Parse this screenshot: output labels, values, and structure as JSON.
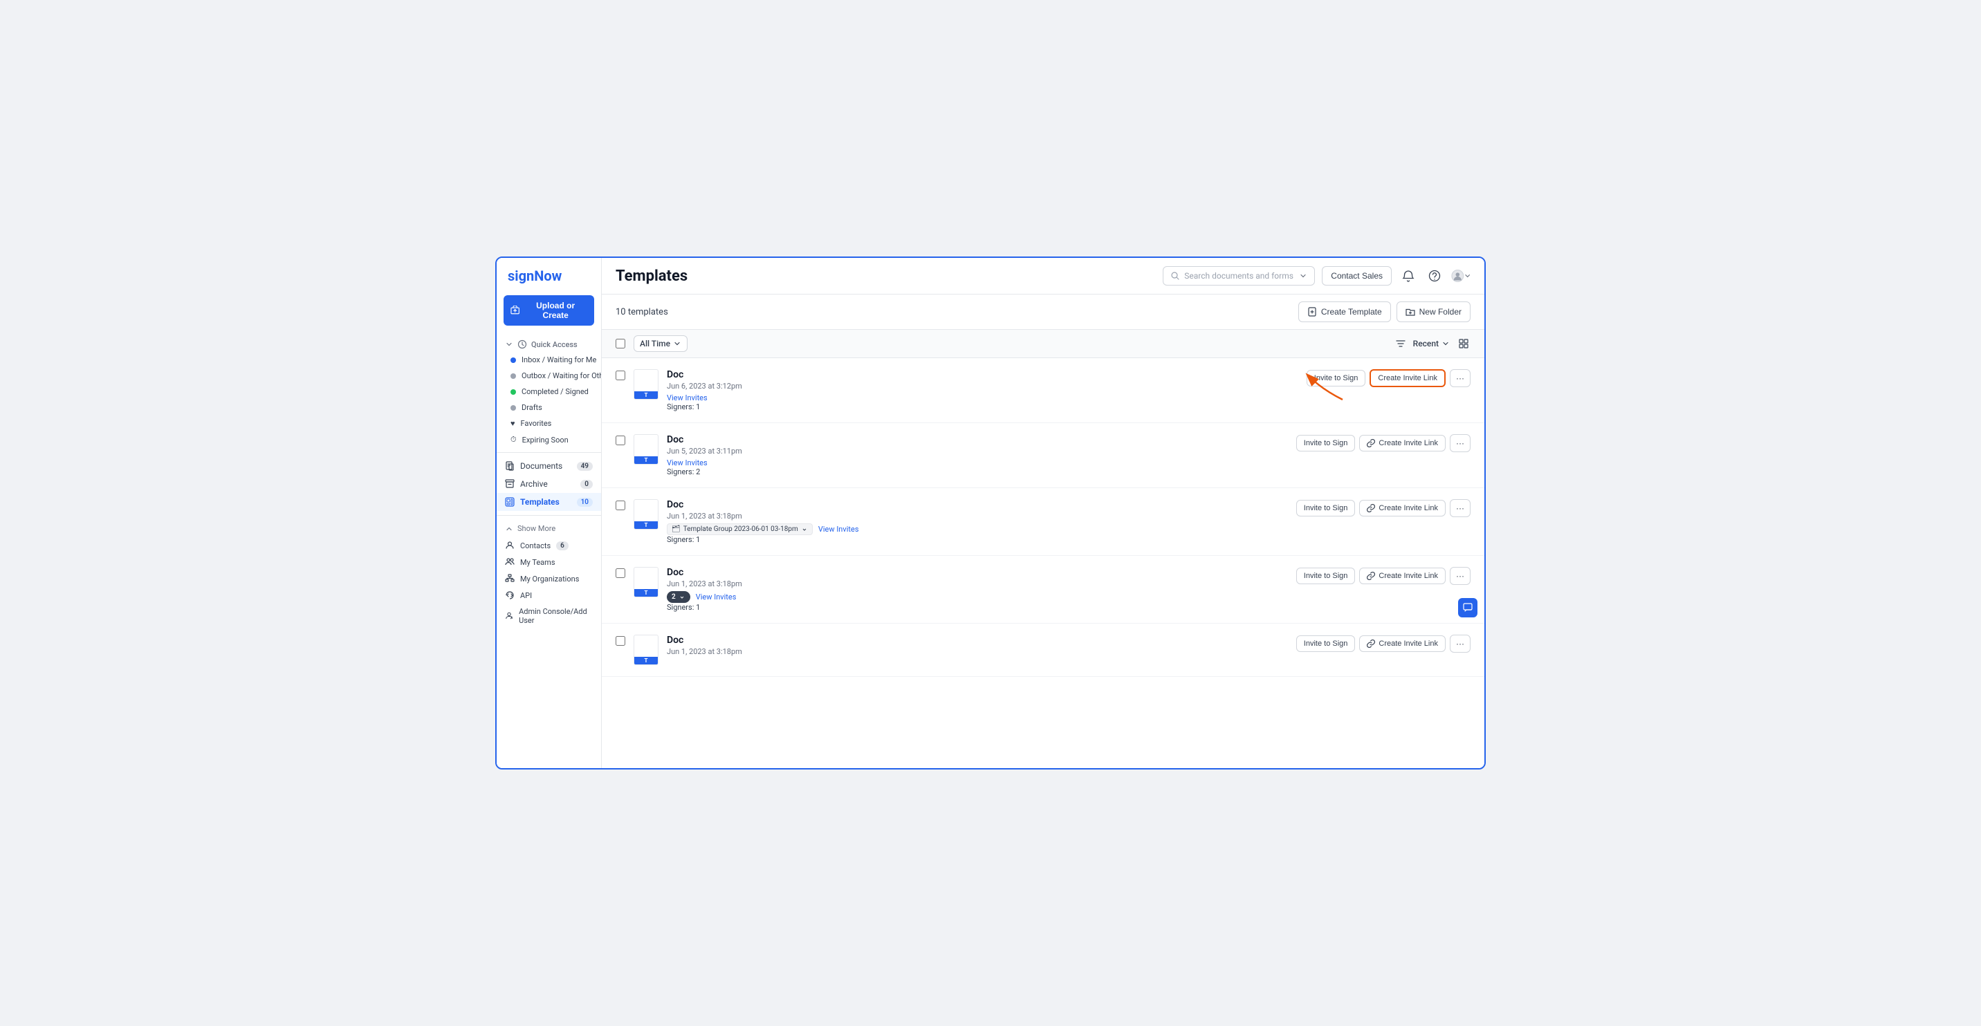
{
  "app": {
    "logo": "signNow",
    "brand_color": "#2563eb"
  },
  "sidebar": {
    "upload_btn": "Upload or Create",
    "quick_access_label": "Quick Access",
    "nav_items": [
      {
        "id": "inbox",
        "label": "Inbox / Waiting for Me",
        "dot": "blue"
      },
      {
        "id": "outbox",
        "label": "Outbox / Waiting for Others",
        "dot": "gray"
      },
      {
        "id": "completed",
        "label": "Completed / Signed",
        "dot": "green"
      },
      {
        "id": "drafts",
        "label": "Drafts",
        "dot": "gray"
      },
      {
        "id": "favorites",
        "label": "Favorites",
        "dot": "heart"
      },
      {
        "id": "expiring",
        "label": "Expiring Soon",
        "dot": "clock"
      }
    ],
    "main_items": [
      {
        "id": "documents",
        "label": "Documents",
        "count": "49",
        "icon": "doc"
      },
      {
        "id": "archive",
        "label": "Archive",
        "count": "0",
        "icon": "archive"
      },
      {
        "id": "templates",
        "label": "Templates",
        "count": "10",
        "icon": "template",
        "active": true
      }
    ],
    "show_more": "Show More",
    "bottom_items": [
      {
        "id": "contacts",
        "label": "Contacts",
        "count": "6"
      },
      {
        "id": "my-teams",
        "label": "My Teams"
      },
      {
        "id": "my-orgs",
        "label": "My Organizations"
      },
      {
        "id": "api",
        "label": "API"
      },
      {
        "id": "admin",
        "label": "Admin Console/Add User"
      }
    ]
  },
  "header": {
    "title": "Templates",
    "search_placeholder": "Search documents and forms",
    "contact_sales": "Contact Sales"
  },
  "toolbar": {
    "count_label": "10 templates",
    "create_template": "Create Template",
    "new_folder": "New Folder"
  },
  "filter": {
    "all_time": "All Time",
    "recent": "Recent"
  },
  "documents": [
    {
      "id": "doc1",
      "name": "Doc",
      "date": "Jun 6, 2023 at 3:12pm",
      "link": "View Invites",
      "signers": "Signers: 1",
      "tag": null,
      "invite_btn": "Invite to Sign",
      "link_btn": "Create Invite Link",
      "highlighted": true
    },
    {
      "id": "doc2",
      "name": "Doc",
      "date": "Jun 5, 2023 at 3:11pm",
      "link": "View Invites",
      "signers": "Signers: 2",
      "tag": null,
      "invite_btn": "Invite to Sign",
      "link_btn": "Create Invite Link",
      "highlighted": false
    },
    {
      "id": "doc3",
      "name": "Doc",
      "date": "Jun 1, 2023 at 3:18pm",
      "link": "View Invites",
      "signers": "Signers: 1",
      "tag": "Template Group 2023-06-01 03-18pm",
      "invite_btn": "Invite to Sign",
      "link_btn": "Create Invite Link",
      "highlighted": false
    },
    {
      "id": "doc4",
      "name": "Doc",
      "date": "Jun 1, 2023 at 3:18pm",
      "link": "View Invites",
      "signers": "Signers: 1",
      "tag2": "2",
      "invite_btn": "Invite to Sign",
      "link_btn": "Create Invite Link",
      "highlighted": false
    },
    {
      "id": "doc5",
      "name": "Doc",
      "date": "Jun 1, 2023 at 3:18pm",
      "link": null,
      "signers": null,
      "tag": null,
      "invite_btn": "Invite to Sign",
      "link_btn": "Create Invite Link",
      "highlighted": false
    }
  ]
}
